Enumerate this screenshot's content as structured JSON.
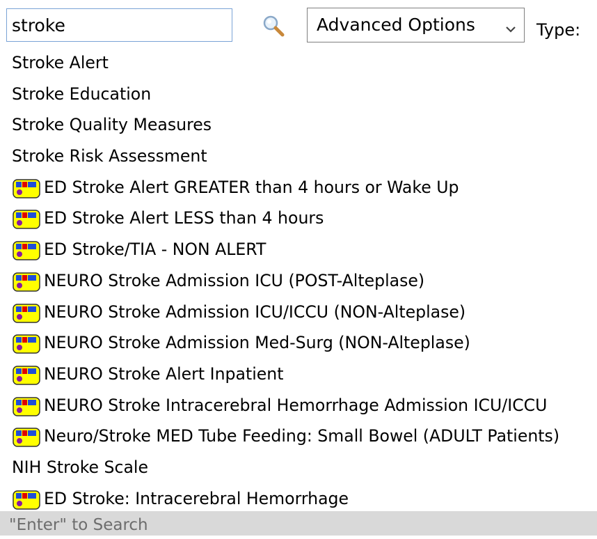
{
  "search": {
    "value": "stroke"
  },
  "advanced": {
    "label": "Advanced Options"
  },
  "type_label": "Type:",
  "results": [
    {
      "label": "Stroke Alert",
      "icon": null
    },
    {
      "label": "Stroke Education",
      "icon": null
    },
    {
      "label": "Stroke Quality Measures",
      "icon": null
    },
    {
      "label": "Stroke Risk Assessment",
      "icon": null
    },
    {
      "label": "ED Stroke Alert GREATER than 4 hours or Wake Up",
      "icon": "order-set-icon"
    },
    {
      "label": "ED Stroke Alert LESS than 4 hours",
      "icon": "order-set-icon"
    },
    {
      "label": "ED Stroke/TIA - NON ALERT",
      "icon": "order-set-icon"
    },
    {
      "label": "NEURO Stroke Admission ICU (POST-Alteplase)",
      "icon": "order-set-icon"
    },
    {
      "label": "NEURO Stroke Admission ICU/ICCU (NON-Alteplase)",
      "icon": "order-set-icon"
    },
    {
      "label": "NEURO Stroke Admission Med-Surg (NON-Alteplase)",
      "icon": "order-set-icon"
    },
    {
      "label": "NEURO Stroke Alert Inpatient",
      "icon": "order-set-icon"
    },
    {
      "label": "NEURO Stroke Intracerebral Hemorrhage Admission ICU/ICCU",
      "icon": "order-set-icon"
    },
    {
      "label": "Neuro/Stroke MED Tube Feeding: Small Bowel (ADULT Patients)",
      "icon": "order-set-icon"
    },
    {
      "label": "NIH Stroke Scale",
      "icon": null
    },
    {
      "label": "ED Stroke: Intracerebral Hemorrhage",
      "icon": "order-set-icon"
    }
  ],
  "footer": {
    "hint": "\"Enter\" to Search"
  },
  "colors": {
    "icon_fill": "#ffff00",
    "icon_blue": "#1f4ed8",
    "icon_red": "#e00000",
    "icon_purple": "#8b1a9e",
    "input_border": "#7aa3d6",
    "footer_bg": "#d9d9d9"
  }
}
